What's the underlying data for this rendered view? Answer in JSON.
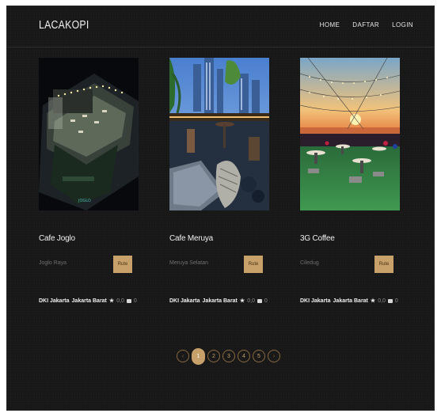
{
  "nav": {
    "brand": "LACAKOPI",
    "links": [
      "HOME",
      "DAFTAR",
      "LOGIN"
    ]
  },
  "cafes": [
    {
      "name": "Cafe Joglo",
      "area": "Joglo Raya",
      "route_label": "Rute",
      "province": "DKI Jakarta",
      "city": "Jakarta Barat",
      "rating": "0,0",
      "comments": "0",
      "photo": "night-rooftop-cafe"
    },
    {
      "name": "Cafe Meruya",
      "area": "Meruya Selatan",
      "route_label": "Rute",
      "province": "DKI Jakarta",
      "city": "Jakarta Barat",
      "rating": "0,0",
      "comments": "0",
      "photo": "city-skyline-terrace"
    },
    {
      "name": "3G Coffee",
      "area": "Ciledug",
      "route_label": "Rute",
      "province": "DKI Jakarta",
      "city": "Jakarta Barat",
      "rating": "0,0",
      "comments": "0",
      "photo": "sunset-rooftop-lawn"
    }
  ],
  "pagination": {
    "prev": "‹",
    "pages": [
      "1",
      "2",
      "3",
      "4",
      "5"
    ],
    "active": "1",
    "next": "›"
  },
  "colors": {
    "background": "#171717",
    "accent": "#c8a06a"
  }
}
